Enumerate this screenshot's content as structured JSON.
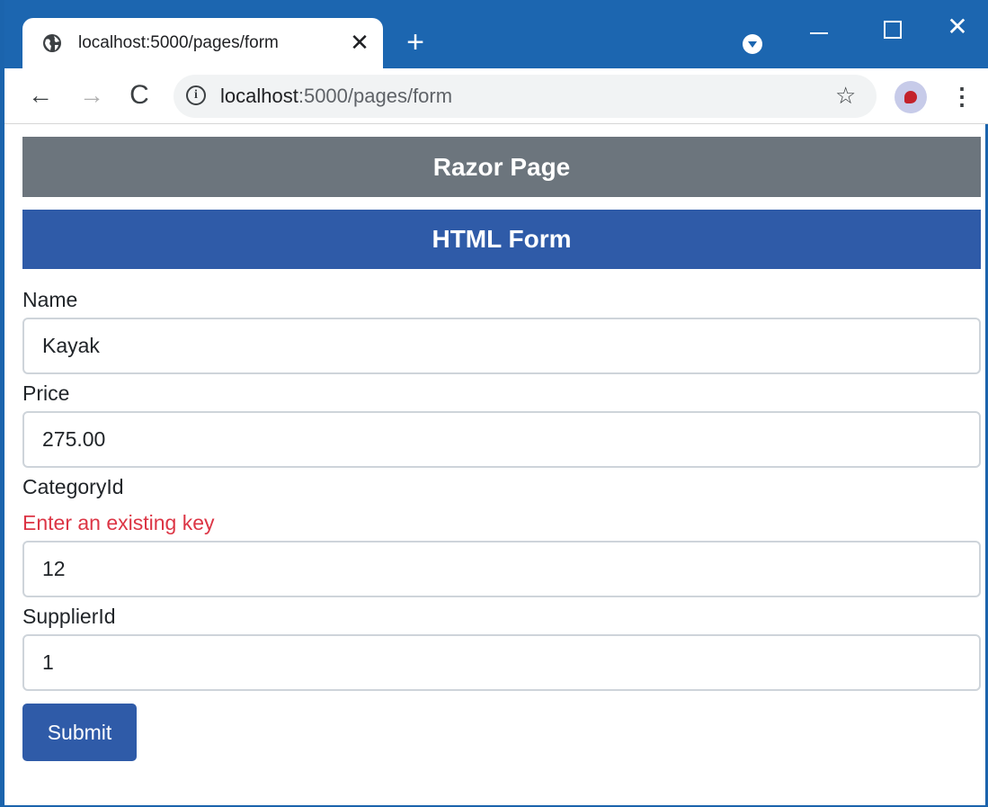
{
  "browser": {
    "tab_title": "localhost:5000/pages/form",
    "tab_close": "✕",
    "new_tab": "+",
    "window_close": "✕",
    "url_host": "localhost",
    "url_path": ":5000/pages/form",
    "icons": {
      "tab_favicon": "globe-icon",
      "back": "arrow-left-icon",
      "forward": "arrow-right-icon",
      "reload": "reload-icon",
      "site_info": "info-icon",
      "bookmark": "star-icon",
      "menu": "kebab-icon"
    },
    "glyphs": {
      "back": "←",
      "forward": "→",
      "reload": "C",
      "info": "i",
      "star": "☆",
      "menu": "⋮"
    },
    "colors": {
      "tabstrip": "#1c66b0",
      "omnibox": "#f1f3f4"
    }
  },
  "page": {
    "header_title": "Razor Page",
    "form_title": "HTML Form",
    "fields": {
      "name": {
        "label": "Name",
        "value": "Kayak"
      },
      "price": {
        "label": "Price",
        "value": "275.00"
      },
      "category": {
        "label": "CategoryId",
        "error": "Enter an existing key",
        "value": "12"
      },
      "supplier": {
        "label": "SupplierId",
        "value": "1"
      }
    },
    "submit_label": "Submit",
    "colors": {
      "header_bg": "#6c757d",
      "primary": "#2f5ba8",
      "error": "#dc3545"
    }
  }
}
